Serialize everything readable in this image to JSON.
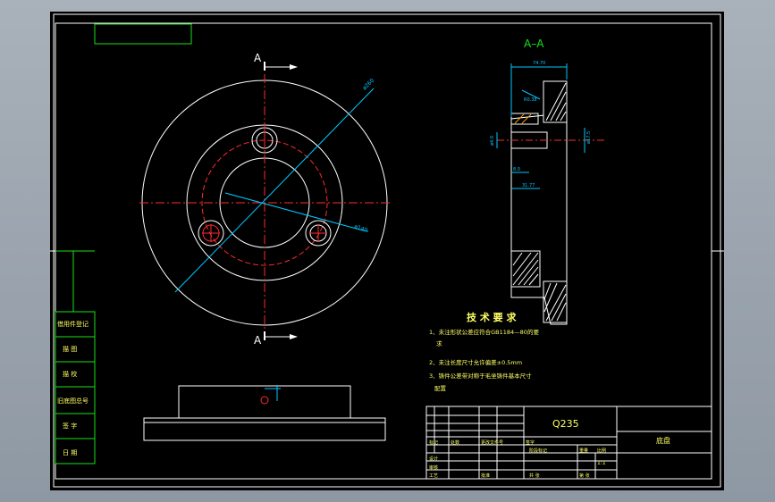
{
  "drawing": {
    "section_label": "A–A",
    "view_label_top": "A",
    "view_label_bottom": "A",
    "tech_req": {
      "title": "技 术 要 求",
      "items": [
        "1、未注形状公差应符合GB1184—80的要",
        "求",
        "2、未注长度尺寸允许偏差±0.5mm",
        "3、铸件公差带对称于毛坐铸件基本尺寸",
        "配置"
      ]
    },
    "title_block": {
      "material": "Q235",
      "part_name": "底盘",
      "scale": "1:1"
    },
    "side_table": {
      "rows": [
        "借用件登记",
        "描 图",
        "描 校",
        "旧底图总号",
        "签 字",
        "日 期"
      ]
    }
  },
  "colors": {
    "line": "#ffffff",
    "center": "#ff2a2a",
    "dim": "#00c8ff",
    "frame": "#18e018",
    "text": "#ffff66"
  }
}
